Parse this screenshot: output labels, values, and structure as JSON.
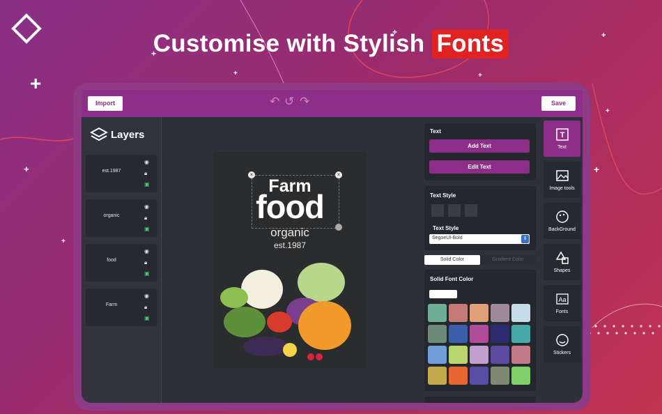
{
  "headline": {
    "prefix": "Customise with Stylish",
    "highlight": "Fonts"
  },
  "topbar": {
    "import_label": "Import",
    "save_label": "Save"
  },
  "layers": {
    "title": "Layers",
    "items": [
      {
        "label": "est.1987"
      },
      {
        "label": "organic"
      },
      {
        "label": "food"
      },
      {
        "label": "Farm"
      }
    ]
  },
  "canvas": {
    "line1": "Farm",
    "line2": "food",
    "line3": "organic",
    "line4": "est.1987"
  },
  "text_panel": {
    "title": "Text",
    "add_label": "Add Text",
    "edit_label": "Edit Text"
  },
  "text_style": {
    "title": "Text Style",
    "font_label": "Text Style",
    "font_value": "SegoeUI-Bold"
  },
  "color_tabs": {
    "solid": "Solid Color",
    "gradient": "Gradient Color"
  },
  "font_color": {
    "title": "Solid Font Color",
    "swatches": [
      "#6fae95",
      "#c47b78",
      "#e0a077",
      "#9e8a98",
      "#c5dde6",
      "#6b8a77",
      "#3b5ea8",
      "#b14c9a",
      "#2a2c6e",
      "#47a9a8",
      "#6f9fd6",
      "#b8d66b",
      "#c29fcf",
      "#5a4aa0",
      "#c27a86",
      "#c4a94e",
      "#e8662f",
      "#5a4ea4",
      "#7f8a76",
      "#7fcf6b"
    ]
  },
  "tools": [
    {
      "label": "Text",
      "icon": "text-tool-icon"
    },
    {
      "label": "Image tools",
      "icon": "image-icon"
    },
    {
      "label": "BackGround",
      "icon": "background-icon"
    },
    {
      "label": "Shapes",
      "icon": "shapes-icon"
    },
    {
      "label": "Fonts",
      "icon": "fonts-icon"
    },
    {
      "label": "Stickers",
      "icon": "stickers-icon"
    }
  ],
  "colors": {
    "accent": "#8e2e88",
    "highlight": "#e02222",
    "dark_bg": "#2e313a",
    "panel_bg": "#24272e"
  }
}
